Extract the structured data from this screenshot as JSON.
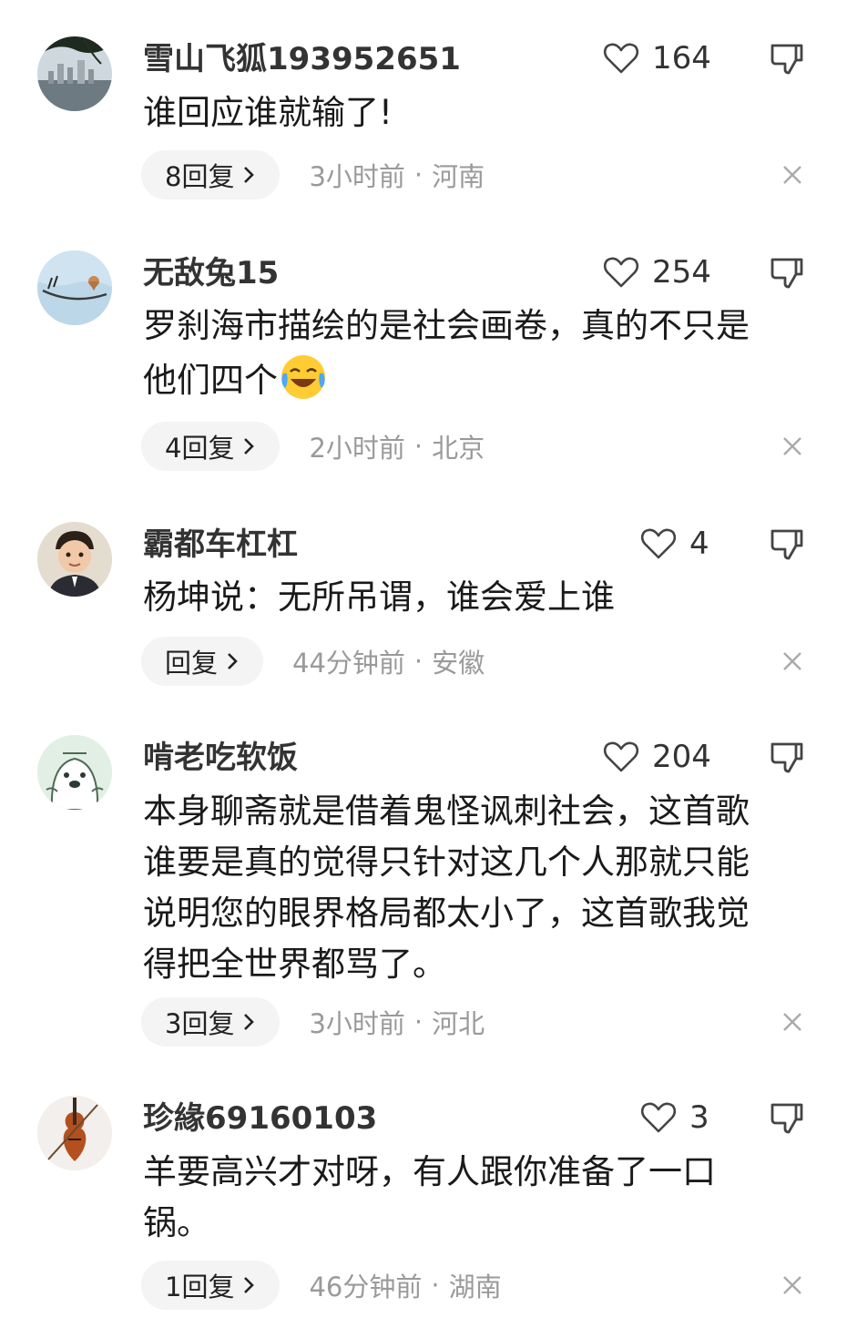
{
  "comments": [
    {
      "username": "雪山飞狐193952651",
      "likes": "164",
      "text": "谁回应谁就输了!",
      "replies": "8回复",
      "time": "3小时前",
      "separator": "·",
      "location": "河南",
      "avatar": "city-skyline-avatar"
    },
    {
      "username": "无敌兔15",
      "likes": "254",
      "text": "罗刹海市描绘的是社会画卷，真的不只是他们四个",
      "emoji": "crying-laughing-emoji",
      "replies": "4回复",
      "time": "2小时前",
      "separator": "·",
      "location": "北京",
      "avatar": "bird-sketch-avatar"
    },
    {
      "username": "霸都车杠杠",
      "likes": "4",
      "text": "杨坤说：无所吊谓，谁会爱上谁",
      "replies": "回复",
      "time": "44分钟前",
      "separator": "·",
      "location": "安徽",
      "avatar": "boy-portrait-avatar"
    },
    {
      "username": "啃老吃软饭",
      "likes": "204",
      "text": "本身聊斋就是借着鬼怪讽刺社会，这首歌谁要是真的觉得只针对这几个人那就只能说明您的眼界格局都太小了，这首歌我觉得把全世界都骂了。",
      "replies": "3回复",
      "time": "3小时前",
      "separator": "·",
      "location": "河北",
      "avatar": "cartoon-seal-avatar"
    },
    {
      "username": "珍緣69160103",
      "likes": "3",
      "text": "羊要高兴才对呀，有人跟你准备了一口锅。",
      "replies": "1回复",
      "time": "46分钟前",
      "separator": "·",
      "location": "湖南",
      "avatar": "violin-avatar"
    }
  ],
  "icons": {
    "like": "heart-outline-icon",
    "dislike": "thumbs-down-outline-icon",
    "reply_arrow": "chevron-right-icon",
    "dismiss": "close-icon"
  },
  "colors": {
    "text": "#1a1a1a",
    "meta": "#9a9a9a",
    "pill": "#f4f4f4"
  }
}
